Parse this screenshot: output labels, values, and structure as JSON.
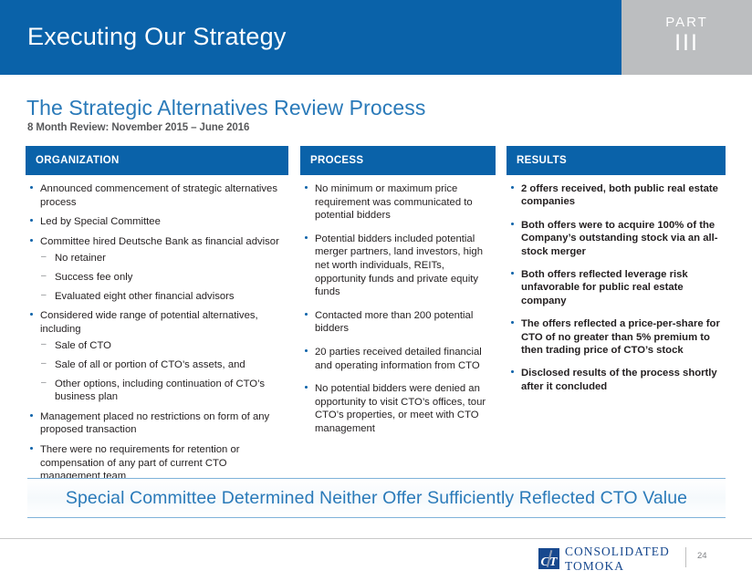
{
  "header": {
    "title": "Executing Our Strategy",
    "part_label": "PART",
    "part_number": "III",
    "blue": "#0a62a9",
    "gray": "#bcbec0"
  },
  "slide": {
    "title": "The Strategic Alternatives Review Process",
    "subtitle": "8 Month Review: November 2015 – June 2016",
    "title_color": "#2a7ab9"
  },
  "columns": [
    {
      "id": "organization",
      "heading": "ORGANIZATION",
      "bold": false,
      "items": [
        {
          "text": "Announced commencement of strategic alternatives process"
        },
        {
          "text": "Led by Special Committee"
        },
        {
          "text": "Committee hired Deutsche Bank as financial advisor",
          "sub": [
            "No retainer",
            "Success fee only",
            "Evaluated eight other financial advisors"
          ]
        },
        {
          "text": "Considered wide range of potential alternatives, including",
          "sub": [
            "Sale of CTO",
            "Sale of all or portion of CTO’s assets, and",
            "Other options, including continuation of CTO’s business plan"
          ]
        },
        {
          "text": "Management placed no restrictions on form of any proposed transaction"
        },
        {
          "text": "There were no requirements for retention or compensation of any part of current CTO management team"
        }
      ]
    },
    {
      "id": "process",
      "heading": "PROCESS",
      "bold": false,
      "items": [
        {
          "text": "No minimum or maximum price requirement was communicated to potential bidders"
        },
        {
          "text": "Potential bidders included potential merger partners, land investors, high net worth individuals, REITs, opportunity funds and private equity funds"
        },
        {
          "text": "Contacted more than 200 potential bidders"
        },
        {
          "text": "20 parties received detailed financial and operating information from CTO"
        },
        {
          "text": "No potential bidders were denied an opportunity to visit CTO’s offices, tour CTO’s properties, or meet with CTO management"
        }
      ]
    },
    {
      "id": "results",
      "heading": "RESULTS",
      "bold": true,
      "items": [
        {
          "text": "2 offers received, both public real estate companies"
        },
        {
          "text": "Both offers were to acquire 100% of the Company’s outstanding stock via an all-stock merger"
        },
        {
          "text": "Both offers reflected leverage risk unfavorable for public real estate company"
        },
        {
          "text": "The offers reflected a price-per-share for CTO of no greater than 5% premium to then trading price of CTO’s stock"
        },
        {
          "text": "Disclosed results of the process shortly after it concluded"
        }
      ]
    }
  ],
  "banner": {
    "text": "Special Committee Determined Neither Offer Sufficiently Reflected CTO Value",
    "color": "#2a7ab9"
  },
  "footer": {
    "logo_mark_text": "CT",
    "logo_line1": "CONSOLIDATED",
    "logo_line2": "TOMOKA",
    "page_number": "24",
    "logo_color": "#17488e"
  }
}
